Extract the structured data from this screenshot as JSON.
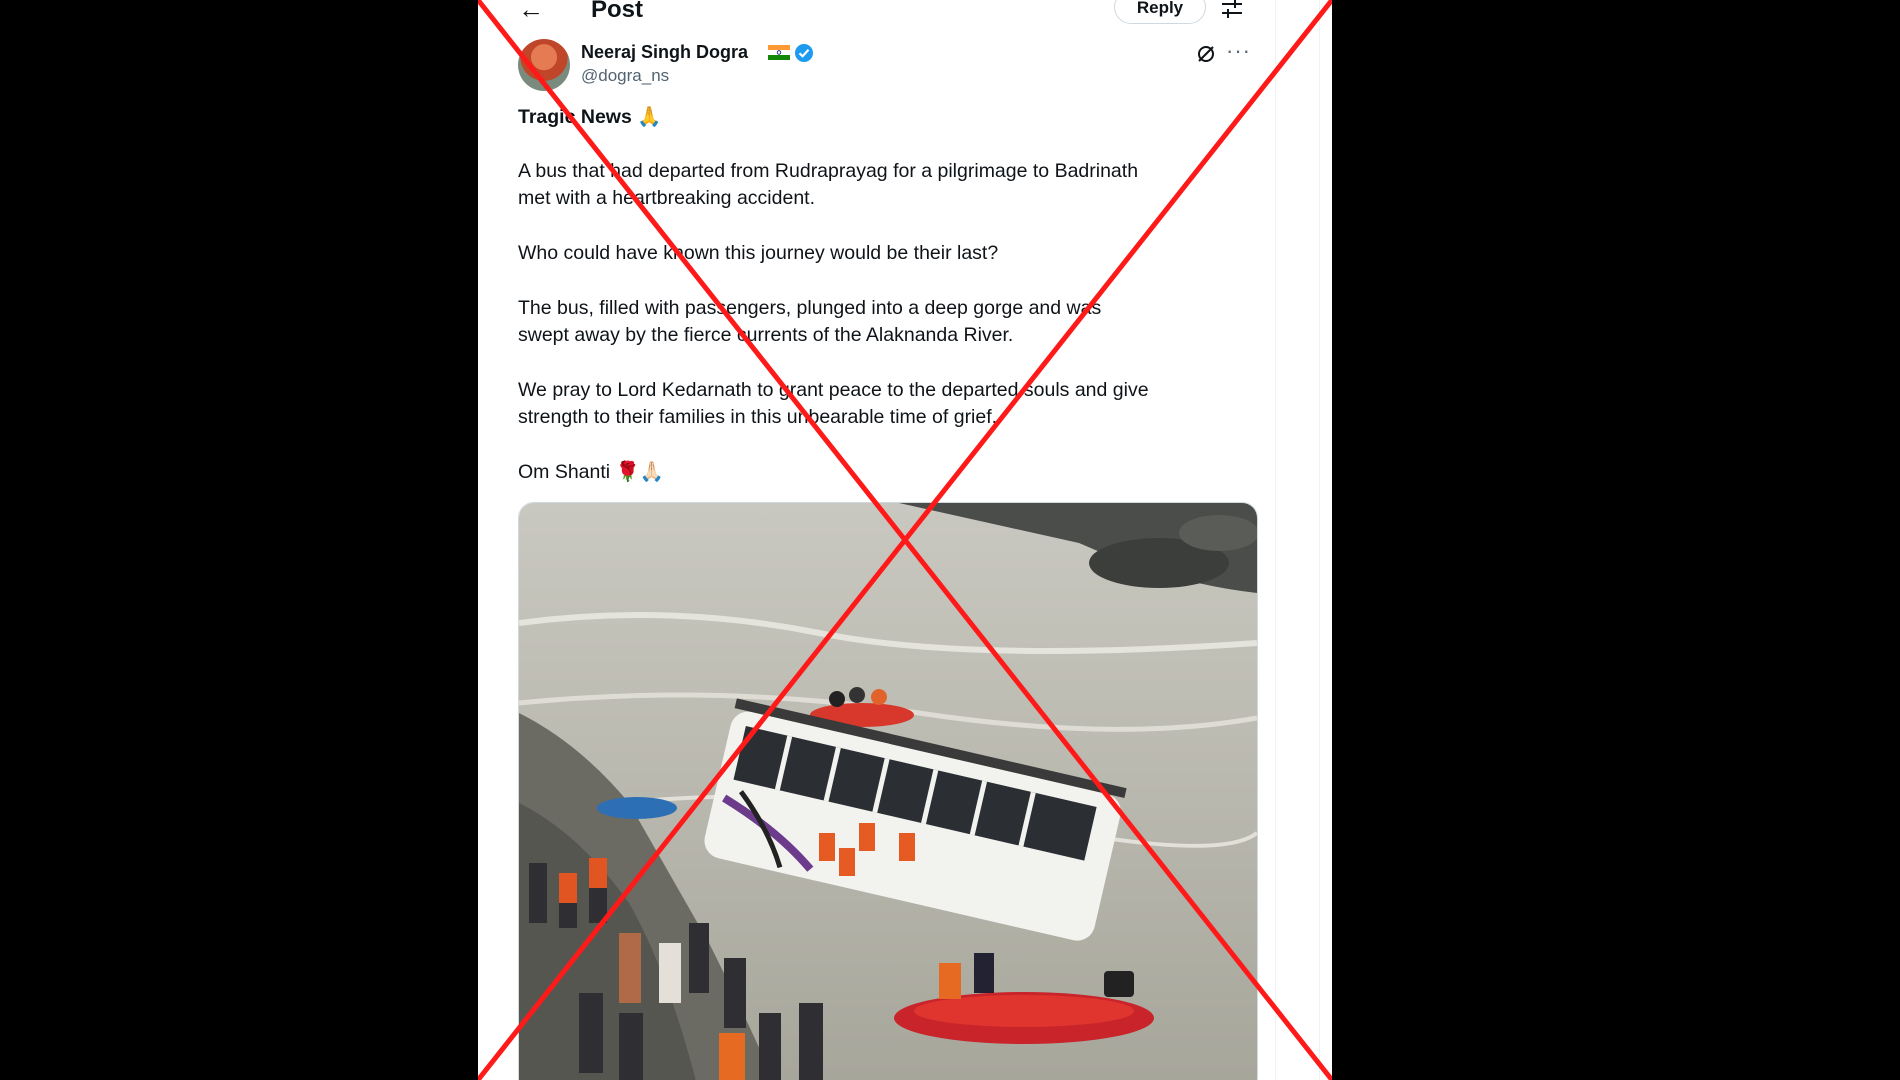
{
  "header": {
    "title": "Post",
    "reply_label": "Reply"
  },
  "icons": {
    "back": "back-arrow-icon",
    "filter": "sliders-icon",
    "grok": "grok-icon",
    "more": "more-icon",
    "verified": "verified-badge-icon",
    "flag": "india-flag-icon"
  },
  "author": {
    "name": "Neeraj Singh Dogra",
    "handle": "@dogra_ns"
  },
  "tweet": {
    "headline": "Tragic News 🙏",
    "p1": "A bus that had departed from Rudraprayag for a pilgrimage to Badrinath\nmet with a heartbreaking accident.",
    "p2": "Who could have known this journey would be their last?",
    "p3": "The bus, filled with passengers, plunged into a deep gorge and was\nswept away by the fierce currents of the Alaknanda River.",
    "p4": "We pray to Lord Kedarnath to grant peace to the departed souls and give\nstrength to their families in this unbearable time of grief.",
    "p5": "Om Shanti 🌹🙏🏻"
  },
  "colors": {
    "accent": "#1d9bf0",
    "overlay_x": "#ff0000",
    "text": "#0f1419",
    "muted": "#536471"
  }
}
